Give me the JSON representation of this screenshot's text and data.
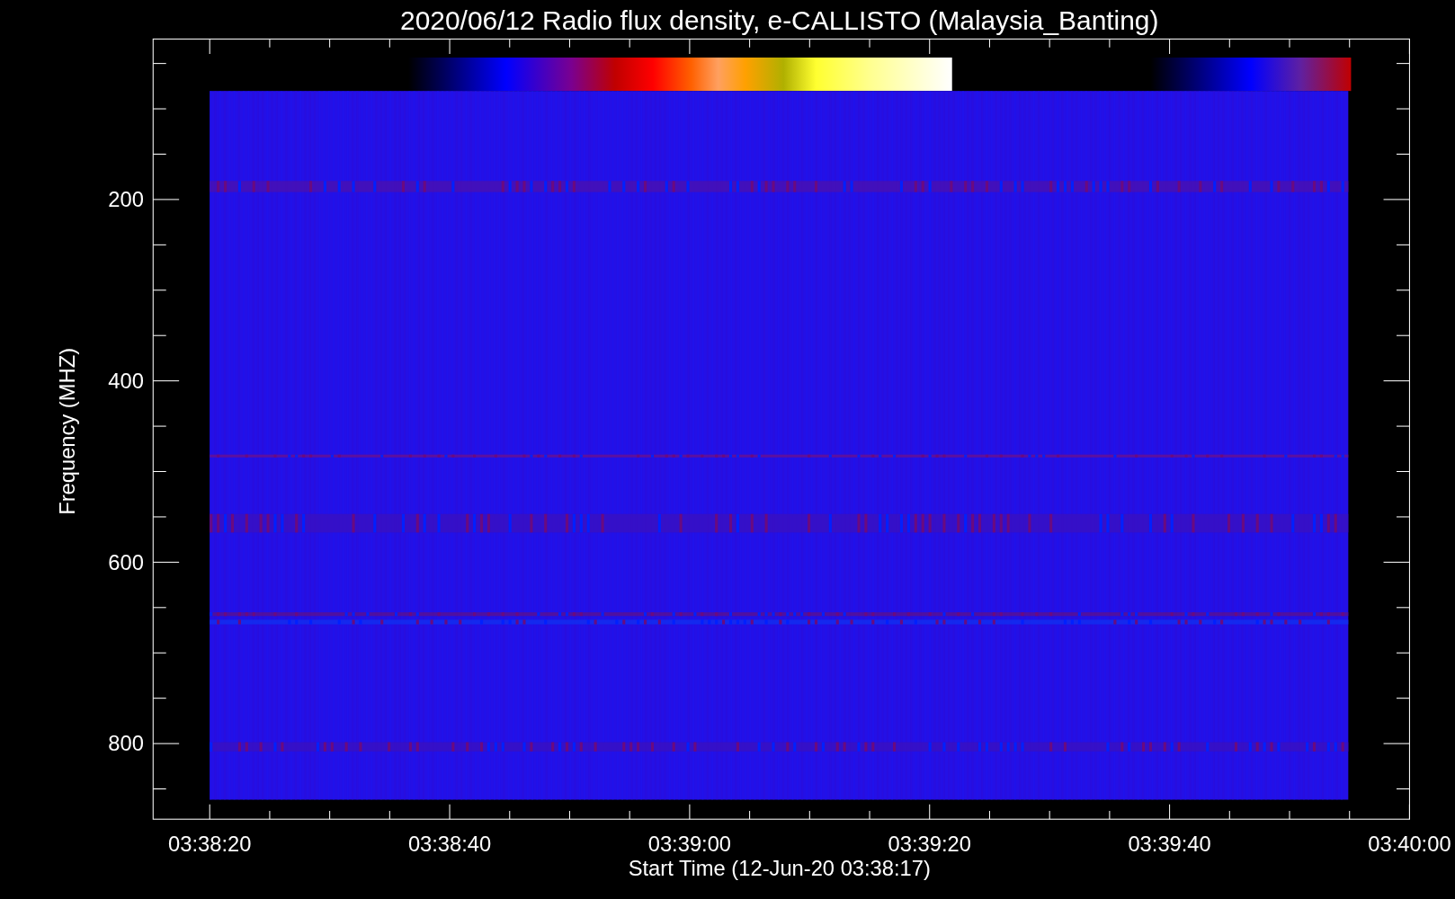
{
  "plot": {
    "title": "2020/06/12  Radio flux density, e-CALLISTO (Malaysia_Banting)",
    "ylabel": "Frequency (MHZ)",
    "xlabel": "Start Time (12-Jun-20 03:38:17)",
    "xtick_labels": [
      "03:38:20",
      "03:38:40",
      "03:39:00",
      "03:39:20",
      "03:39:40",
      "03:40:00"
    ],
    "ytick_labels": [
      "200",
      "400",
      "600",
      "800"
    ]
  }
}
